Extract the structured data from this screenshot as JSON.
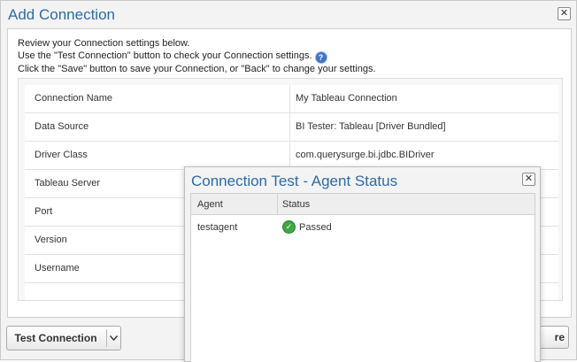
{
  "dialog": {
    "title": "Add Connection",
    "close_icon": "close-icon",
    "intro": [
      "Review your Connection settings below.",
      "Use the \"Test Connection\" button to check your Connection settings.",
      "Click the \"Save\" button to save your Connection, or \"Back\" to change your settings."
    ],
    "help_icon": "help-icon",
    "settings": [
      {
        "label": "Connection Name",
        "value": "My Tableau Connection"
      },
      {
        "label": "Data Source",
        "value": "BI Tester: Tableau [Driver Bundled]"
      },
      {
        "label": "Driver Class",
        "value": "com.querysurge.bi.jdbc.BIDriver"
      },
      {
        "label": "Tableau Server",
        "value": ""
      },
      {
        "label": "Port",
        "value": ""
      },
      {
        "label": "Version",
        "value": ""
      },
      {
        "label": "Username",
        "value": ""
      }
    ],
    "buttons": {
      "test_connection": "Test Connection",
      "right_partial": "re"
    }
  },
  "connection_test": {
    "title": "Connection Test - Agent Status",
    "columns": [
      "Agent",
      "Status"
    ],
    "rows": [
      {
        "agent": "testagent",
        "status": "Passed",
        "status_icon": "check-circle-icon"
      }
    ]
  },
  "colors": {
    "title": "#2f6aa3",
    "passed": "#3fa844",
    "help": "#3f74c5"
  }
}
